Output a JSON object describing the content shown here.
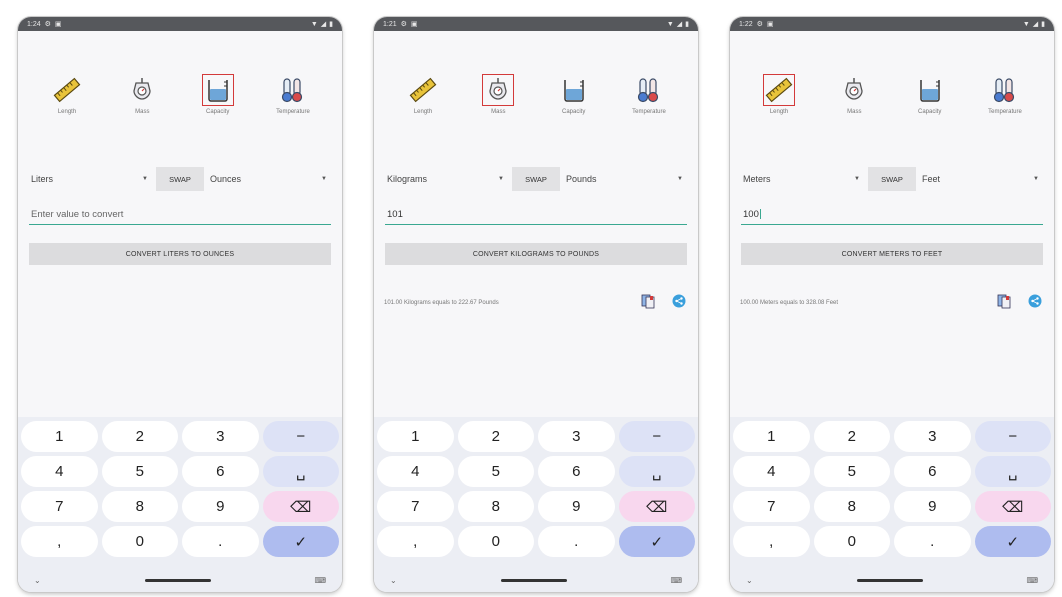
{
  "colors": {
    "accent": "#3aa891",
    "selected_outline": "#d33a3a",
    "ok_key": "#aebcef",
    "fn_key": "#dde2f6",
    "del_key": "#f8d7ee"
  },
  "phones": [
    {
      "status": {
        "time": "1:24"
      },
      "categories": [
        {
          "label": "Length",
          "icon": "ruler-icon"
        },
        {
          "label": "Mass",
          "icon": "scale-icon"
        },
        {
          "label": "Capacity",
          "icon": "beaker-icon"
        },
        {
          "label": "Temperature",
          "icon": "thermometer-icon"
        }
      ],
      "selected_category": "Capacity",
      "from_unit": "Liters",
      "swap_label": "SWAP",
      "to_unit": "Ounces",
      "input_placeholder": "Enter value to convert",
      "input_value": "",
      "convert_label": "CONVERT LITERS TO OUNCES",
      "result_text": ""
    },
    {
      "status": {
        "time": "1:21"
      },
      "categories": [
        {
          "label": "Length",
          "icon": "ruler-icon"
        },
        {
          "label": "Mass",
          "icon": "scale-icon"
        },
        {
          "label": "Capacity",
          "icon": "beaker-icon"
        },
        {
          "label": "Temperature",
          "icon": "thermometer-icon"
        }
      ],
      "selected_category": "Mass",
      "from_unit": "Kilograms",
      "swap_label": "SWAP",
      "to_unit": "Pounds",
      "input_placeholder": "Enter value to convert",
      "input_value": "101",
      "convert_label": "CONVERT KILOGRAMS TO POUNDS",
      "result_text": "101.00 Kilograms equals to 222.67 Pounds"
    },
    {
      "status": {
        "time": "1:22"
      },
      "categories": [
        {
          "label": "Length",
          "icon": "ruler-icon"
        },
        {
          "label": "Mass",
          "icon": "scale-icon"
        },
        {
          "label": "Capacity",
          "icon": "beaker-icon"
        },
        {
          "label": "Temperature",
          "icon": "thermometer-icon"
        }
      ],
      "selected_category": "Length",
      "from_unit": "Meters",
      "swap_label": "SWAP",
      "to_unit": "Feet",
      "input_placeholder": "Enter value to convert",
      "input_value": "100",
      "convert_label": "CONVERT METERS TO FEET",
      "result_text": "100.00 Meters equals to 328.08 Feet"
    }
  ],
  "keypad": [
    [
      "1",
      "2",
      "3",
      "−"
    ],
    [
      "4",
      "5",
      "6",
      "␣"
    ],
    [
      "7",
      "8",
      "9",
      "⌫"
    ],
    [
      ",",
      "0",
      ".",
      "✓"
    ]
  ]
}
